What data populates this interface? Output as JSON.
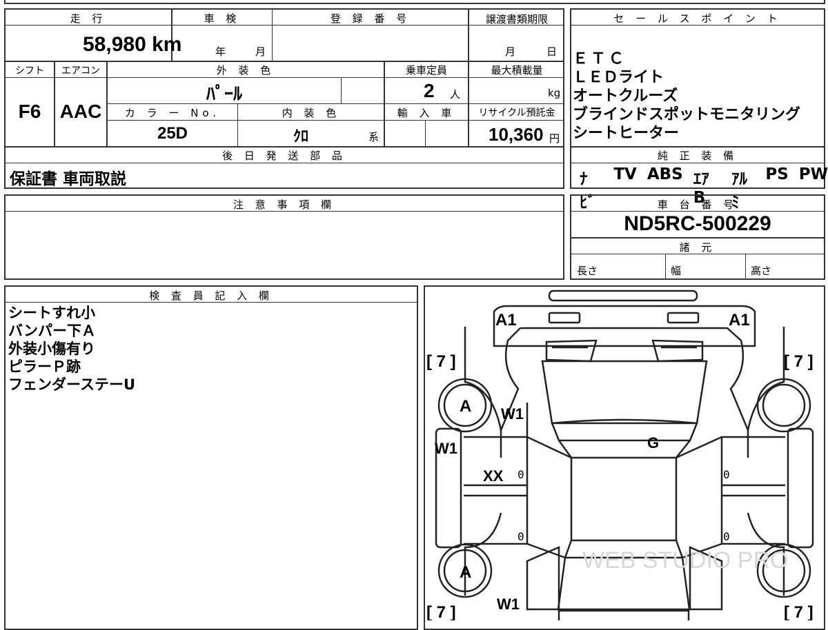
{
  "top": {
    "labels": [
      "走 行",
      "車 検",
      "登 録 番 号",
      "譲渡書類期限"
    ],
    "mileage": "58,980 km",
    "shaken_year": "年",
    "shaken_month": "月",
    "deadline_month": "月",
    "deadline_day": "日"
  },
  "row2": {
    "labels": [
      "シフト",
      "エアコン",
      "外 装 色",
      "乗車定員",
      "最大積載量"
    ],
    "shift": "F6",
    "aircon": "AAC",
    "exterior_color": "ﾊﾟｰﾙ",
    "capacity": "2",
    "capacity_unit": "人",
    "load_unit": "kg"
  },
  "row3": {
    "labels": [
      "カ ラ ー No.",
      "内 装 色",
      "輸 入 車",
      "リサイクル預託金"
    ],
    "color_no": "25D",
    "interior": "ｸﾛ",
    "interior_suffix": "系",
    "recycle": "10,360",
    "recycle_unit": "円"
  },
  "later": {
    "label": "後 日 発 送 部 品",
    "value": "保証書 車両取説"
  },
  "notes": {
    "label": "注 意 事 項 欄"
  },
  "sales": {
    "label": "セ ー ル ス ポ イ ン ト",
    "items": [
      "ＥＴＣ",
      "ＬＥＤライト",
      "オートクルーズ",
      "ブラインドスポットモニタリング",
      "シートヒーター"
    ]
  },
  "equipment": {
    "label": "純 正 装 備",
    "items": [
      "ﾅﾋﾞ",
      "TV",
      "ABS",
      "ｴｱB",
      "ｱﾙﾐ",
      "PS",
      "PW"
    ]
  },
  "chassis": {
    "label": "車 台 番 号",
    "value": "ND5RC-500229"
  },
  "specs": {
    "label": "諸 元",
    "length": "長さ",
    "width": "幅",
    "height": "高さ"
  },
  "inspector": {
    "label": "検 査 員 記 入 欄",
    "lines": [
      "シートすれ小",
      "バンパー下Ａ",
      "外装小傷有り",
      "ピラーＰ跡",
      "フェンダーステーU"
    ]
  },
  "diagram": {
    "marks": {
      "a1_left": "A1",
      "a1_right": "A1",
      "seven_tl": "[ 7 ]",
      "seven_tr": "[ 7 ]",
      "seven_bl": "[ 7 ]",
      "seven_br": "[ 7 ]",
      "a_top": "A",
      "a_bottom": "A",
      "w1_a": "W1",
      "w1_b": "W1",
      "w1_c": "W1",
      "g": "G",
      "xx": "XX",
      "zero1": "0",
      "zero2": "0",
      "zero3": "0",
      "zero4": "0"
    },
    "watermark": "WEB STUDIO PRO"
  }
}
